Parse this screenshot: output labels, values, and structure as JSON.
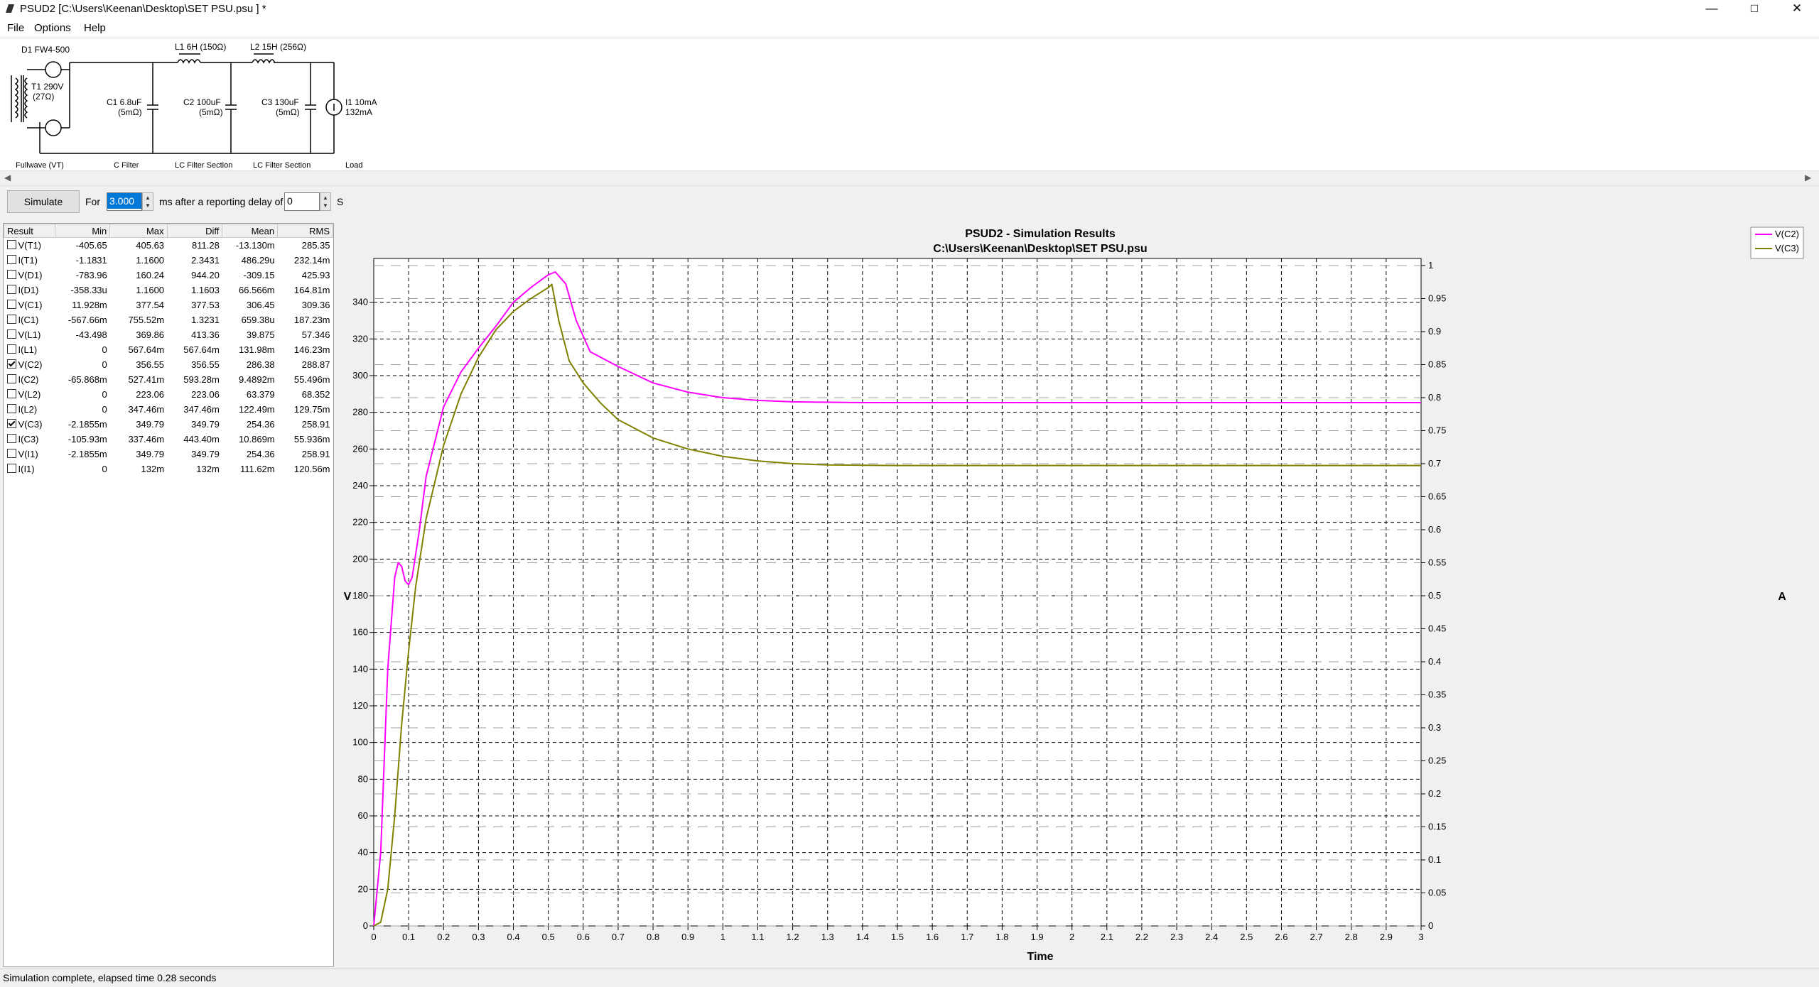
{
  "window": {
    "title": "PSUD2  [C:\\Users\\Keenan\\Desktop\\SET PSU.psu ] *",
    "controls": {
      "minimize": "—",
      "maximize": "□",
      "close": "✕"
    }
  },
  "menu": [
    {
      "label": "File",
      "accel": "F"
    },
    {
      "label": "Options",
      "accel": "O"
    },
    {
      "label": "Help",
      "accel": "H"
    }
  ],
  "schematic": {
    "diode": "D1 FW4-500",
    "transformer": [
      "T1 290V",
      "(27Ω)"
    ],
    "capacitor1": [
      "C1 6.8uF",
      "(5mΩ)"
    ],
    "inductor1": "L1 6H (150Ω)",
    "capacitor2": [
      "C2 100uF",
      "(5mΩ)"
    ],
    "inductor2": "L2 15H (256Ω)",
    "capacitor3": [
      "C3 130uF",
      "(5mΩ)"
    ],
    "load": [
      "I1 10mA",
      "132mA"
    ],
    "sections": [
      "Fullwave (VT)",
      "C Filter",
      "LC Filter Section",
      "LC Filter Section",
      "Load"
    ]
  },
  "toolbar": {
    "simulate_label": "Simulate",
    "for_label": "For",
    "duration_value": "3.000",
    "ms_label": "ms  after a reporting delay of",
    "delay_value": "0",
    "s_label": "S"
  },
  "results": {
    "headers": [
      "Result",
      "Min",
      "Max",
      "Diff",
      "Mean",
      "RMS"
    ],
    "rows": [
      {
        "name": "V(T1)",
        "checked": false,
        "min": "-405.65",
        "max": "405.63",
        "diff": "811.28",
        "mean": "-13.130m",
        "rms": "285.35"
      },
      {
        "name": "I(T1)",
        "checked": false,
        "min": "-1.1831",
        "max": "1.1600",
        "diff": "2.3431",
        "mean": "486.29u",
        "rms": "232.14m"
      },
      {
        "name": "V(D1)",
        "checked": false,
        "min": "-783.96",
        "max": "160.24",
        "diff": "944.20",
        "mean": "-309.15",
        "rms": "425.93"
      },
      {
        "name": "I(D1)",
        "checked": false,
        "min": "-358.33u",
        "max": "1.1600",
        "diff": "1.1603",
        "mean": "66.566m",
        "rms": "164.81m"
      },
      {
        "name": "V(C1)",
        "checked": false,
        "min": "11.928m",
        "max": "377.54",
        "diff": "377.53",
        "mean": "306.45",
        "rms": "309.36"
      },
      {
        "name": "I(C1)",
        "checked": false,
        "min": "-567.66m",
        "max": "755.52m",
        "diff": "1.3231",
        "mean": "659.38u",
        "rms": "187.23m"
      },
      {
        "name": "V(L1)",
        "checked": false,
        "min": "-43.498",
        "max": "369.86",
        "diff": "413.36",
        "mean": "39.875",
        "rms": "57.346"
      },
      {
        "name": "I(L1)",
        "checked": false,
        "min": "0",
        "max": "567.64m",
        "diff": "567.64m",
        "mean": "131.98m",
        "rms": "146.23m"
      },
      {
        "name": "V(C2)",
        "checked": true,
        "min": "0",
        "max": "356.55",
        "diff": "356.55",
        "mean": "286.38",
        "rms": "288.87"
      },
      {
        "name": "I(C2)",
        "checked": false,
        "min": "-65.868m",
        "max": "527.41m",
        "diff": "593.28m",
        "mean": "9.4892m",
        "rms": "55.496m"
      },
      {
        "name": "V(L2)",
        "checked": false,
        "min": "0",
        "max": "223.06",
        "diff": "223.06",
        "mean": "63.379",
        "rms": "68.352"
      },
      {
        "name": "I(L2)",
        "checked": false,
        "min": "0",
        "max": "347.46m",
        "diff": "347.46m",
        "mean": "122.49m",
        "rms": "129.75m"
      },
      {
        "name": "V(C3)",
        "checked": true,
        "min": "-2.1855m",
        "max": "349.79",
        "diff": "349.79",
        "mean": "254.36",
        "rms": "258.91"
      },
      {
        "name": "I(C3)",
        "checked": false,
        "min": "-105.93m",
        "max": "337.46m",
        "diff": "443.40m",
        "mean": "10.869m",
        "rms": "55.936m"
      },
      {
        "name": "V(I1)",
        "checked": false,
        "min": "-2.1855m",
        "max": "349.79",
        "diff": "349.79",
        "mean": "254.36",
        "rms": "258.91"
      },
      {
        "name": "I(I1)",
        "checked": false,
        "min": "0",
        "max": "132m",
        "diff": "132m",
        "mean": "111.62m",
        "rms": "120.56m"
      }
    ]
  },
  "chart_data": {
    "type": "line",
    "title": "PSUD2 - Simulation Results",
    "subtitle": "C:\\Users\\Keenan\\Desktop\\SET PSU.psu",
    "xlabel": "Time",
    "ylabel": "V",
    "y2label": "A",
    "xlim": [
      0,
      3
    ],
    "ylim": [
      0,
      360
    ],
    "y2lim": [
      0,
      1
    ],
    "x_ticks": [
      "0",
      "0.1",
      "0.2",
      "0.3",
      "0.4",
      "0.5",
      "0.6",
      "0.7",
      "0.8",
      "0.9",
      "1",
      "1.1",
      "1.2",
      "1.3",
      "1.4",
      "1.5",
      "1.6",
      "1.7",
      "1.8",
      "1.9",
      "2",
      "2.1",
      "2.2",
      "2.3",
      "2.4",
      "2.5",
      "2.6",
      "2.7",
      "2.8",
      "2.9",
      "3"
    ],
    "y_ticks": [
      "0",
      "20",
      "40",
      "60",
      "80",
      "100",
      "120",
      "140",
      "160",
      "180",
      "200",
      "220",
      "240",
      "260",
      "280",
      "300",
      "320",
      "340"
    ],
    "y2_ticks": [
      "0",
      "0.05",
      "0.1",
      "0.15",
      "0.2",
      "0.25",
      "0.3",
      "0.35",
      "0.4",
      "0.45",
      "0.5",
      "0.55",
      "0.6",
      "0.65",
      "0.7",
      "0.75",
      "0.8",
      "0.85",
      "0.9",
      "0.95",
      "1"
    ],
    "grid": true,
    "legend_position": "top-right",
    "series": [
      {
        "name": "V(C2)",
        "color": "#ff00ff",
        "points": [
          [
            0,
            0
          ],
          [
            0.02,
            40
          ],
          [
            0.04,
            140
          ],
          [
            0.06,
            190
          ],
          [
            0.07,
            198
          ],
          [
            0.08,
            196
          ],
          [
            0.09,
            188
          ],
          [
            0.1,
            186
          ],
          [
            0.11,
            190
          ],
          [
            0.13,
            215
          ],
          [
            0.15,
            245
          ],
          [
            0.2,
            283
          ],
          [
            0.25,
            302
          ],
          [
            0.3,
            315
          ],
          [
            0.35,
            327
          ],
          [
            0.4,
            340
          ],
          [
            0.45,
            348
          ],
          [
            0.5,
            355
          ],
          [
            0.52,
            356.5
          ],
          [
            0.55,
            350
          ],
          [
            0.58,
            330
          ],
          [
            0.62,
            313
          ],
          [
            0.7,
            305
          ],
          [
            0.8,
            296
          ],
          [
            0.9,
            291
          ],
          [
            1.0,
            288
          ],
          [
            1.1,
            286.5
          ],
          [
            1.2,
            285.7
          ],
          [
            1.4,
            285.3
          ],
          [
            1.6,
            285.3
          ],
          [
            2.0,
            285.3
          ],
          [
            2.5,
            285.3
          ],
          [
            3.0,
            285.3
          ]
        ]
      },
      {
        "name": "V(C3)",
        "color": "#808000",
        "points": [
          [
            0,
            0
          ],
          [
            0.02,
            2
          ],
          [
            0.04,
            20
          ],
          [
            0.06,
            60
          ],
          [
            0.08,
            110
          ],
          [
            0.1,
            150
          ],
          [
            0.12,
            185
          ],
          [
            0.15,
            222
          ],
          [
            0.2,
            262
          ],
          [
            0.25,
            290
          ],
          [
            0.3,
            310
          ],
          [
            0.35,
            325
          ],
          [
            0.4,
            335
          ],
          [
            0.45,
            342
          ],
          [
            0.5,
            348
          ],
          [
            0.51,
            349.8
          ],
          [
            0.53,
            330
          ],
          [
            0.56,
            308
          ],
          [
            0.6,
            296
          ],
          [
            0.65,
            285
          ],
          [
            0.7,
            276
          ],
          [
            0.8,
            266
          ],
          [
            0.9,
            260
          ],
          [
            1.0,
            256
          ],
          [
            1.1,
            253.5
          ],
          [
            1.2,
            252
          ],
          [
            1.3,
            251.3
          ],
          [
            1.5,
            251
          ],
          [
            2.0,
            251
          ],
          [
            2.5,
            251
          ],
          [
            3.0,
            251
          ]
        ]
      }
    ]
  },
  "status": "Simulation complete, elapsed time 0.28 seconds"
}
